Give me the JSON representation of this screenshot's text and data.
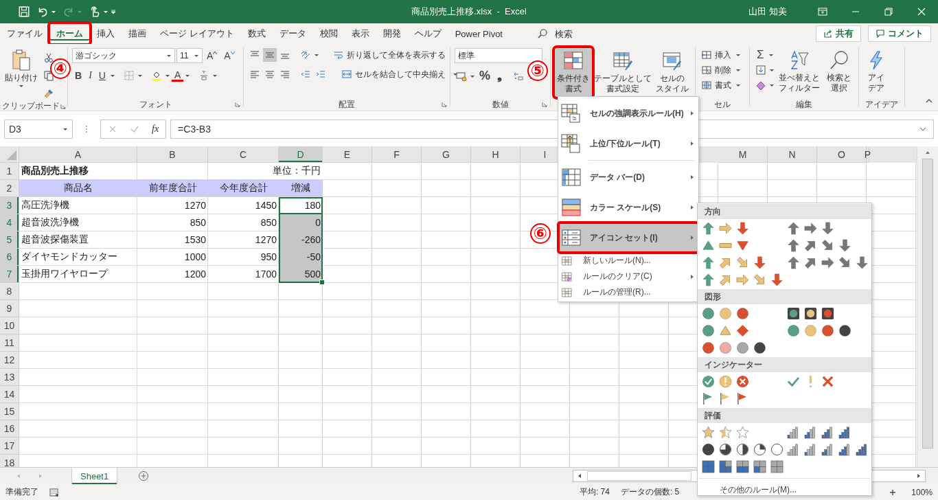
{
  "window": {
    "title": "商品別売上推移.xlsx  -  Excel",
    "user": "山田 知美"
  },
  "ribbon_tabs": [
    {
      "label": "ファイル",
      "selected": false,
      "marked": false
    },
    {
      "label": "ホーム",
      "selected": true,
      "marked": true
    },
    {
      "label": "挿入",
      "selected": false,
      "marked": false
    },
    {
      "label": "描画",
      "selected": false,
      "marked": false
    },
    {
      "label": "ページ レイアウト",
      "selected": false,
      "marked": false
    },
    {
      "label": "数式",
      "selected": false,
      "marked": false
    },
    {
      "label": "データ",
      "selected": false,
      "marked": false
    },
    {
      "label": "校閲",
      "selected": false,
      "marked": false
    },
    {
      "label": "表示",
      "selected": false,
      "marked": false
    },
    {
      "label": "開発",
      "selected": false,
      "marked": false
    },
    {
      "label": "ヘルプ",
      "selected": false,
      "marked": false
    },
    {
      "label": "Power Pivot",
      "selected": false,
      "marked": false
    }
  ],
  "search": {
    "placeholder": "検索"
  },
  "share_button": "共有",
  "comment_button": "コメント",
  "ribbon": {
    "clipboard": {
      "label": "クリップボード",
      "paste": "貼り付け"
    },
    "font": {
      "label": "フォント",
      "font_name": "游ゴシック",
      "font_size": "11",
      "grow": "A",
      "shrink": "A",
      "styles": [
        "B",
        "I",
        "U"
      ],
      "font_color": "A"
    },
    "alignment": {
      "label": "配置",
      "wrap": "折り返して全体を表示する",
      "merge": "セルを結合して中央揃え"
    },
    "number": {
      "label": "数値",
      "format": "標準",
      "percent": "%",
      "comma": "❟"
    },
    "styles": [
      {
        "lines": [
          "条件付き",
          "書式"
        ],
        "selected": true,
        "marked": true
      },
      {
        "lines": [
          "テーブルとして",
          "書式設定"
        ],
        "selected": false,
        "marked": false
      },
      {
        "lines": [
          "セルの",
          "スタイル"
        ],
        "selected": false,
        "marked": false
      }
    ],
    "cells": {
      "label": "セル",
      "buttons": [
        "挿入",
        "削除",
        "書式"
      ]
    },
    "editing": {
      "label": "編集",
      "autosum": "Σ",
      "buttons": [
        {
          "lines": [
            "並べ替えと",
            "フィルター"
          ]
        },
        {
          "lines": [
            "検索と",
            "選択"
          ]
        }
      ]
    },
    "ideas": {
      "label": "アイデア",
      "lines": [
        "アイ",
        "デア"
      ]
    }
  },
  "name_box": "D3",
  "formula": "=C3-B3",
  "function_button": "fx",
  "columns": [
    {
      "label": "A",
      "selected": false
    },
    {
      "label": "B",
      "selected": false
    },
    {
      "label": "C",
      "selected": false
    },
    {
      "label": "D",
      "selected": true
    },
    {
      "label": "E",
      "selected": false
    },
    {
      "label": "F",
      "selected": false
    },
    {
      "label": "G",
      "selected": false
    },
    {
      "label": "H",
      "selected": false
    },
    {
      "label": "I",
      "selected": false
    },
    {
      "kind": "covered"
    },
    {
      "kind": "covered"
    },
    {
      "kind": "covered"
    },
    {
      "label": "M",
      "selected": false
    },
    {
      "label": "N",
      "selected": false
    },
    {
      "label": "O",
      "selected": false
    },
    {
      "label": "P",
      "selected": false
    }
  ],
  "rows": [
    {
      "header": "1",
      "selected": false,
      "cells": [
        {
          "text": "商品別売上推移",
          "kind": "title",
          "selected": false,
          "active": false
        },
        {
          "kind": "empty"
        },
        {
          "text": "単位：千円",
          "kind": "unit",
          "selected": false,
          "active": false
        }
      ]
    },
    {
      "header": "2",
      "selected": false,
      "cells": [
        {
          "text": "商品名",
          "kind": "header",
          "selected": false,
          "active": false
        },
        {
          "text": "前年度合計",
          "kind": "header",
          "selected": false,
          "active": false
        },
        {
          "text": "今年度合計",
          "kind": "header",
          "selected": false,
          "active": false
        },
        {
          "text": "増減",
          "kind": "header",
          "selected": false,
          "active": false
        }
      ]
    },
    {
      "header": "3",
      "selected": true,
      "cells": [
        {
          "text": "高圧洗浄機",
          "kind": "label",
          "selected": false,
          "active": false
        },
        {
          "text": "1270",
          "kind": "number",
          "selected": false,
          "active": false
        },
        {
          "text": "1450",
          "kind": "number",
          "selected": false,
          "active": false
        },
        {
          "text": "180",
          "kind": "number",
          "selected": true,
          "active": true
        }
      ]
    },
    {
      "header": "4",
      "selected": true,
      "cells": [
        {
          "text": "超音波洗浄機",
          "kind": "label",
          "selected": false,
          "active": false
        },
        {
          "text": "850",
          "kind": "number",
          "selected": false,
          "active": false
        },
        {
          "text": "850",
          "kind": "number",
          "selected": false,
          "active": false
        },
        {
          "text": "0",
          "kind": "number",
          "selected": true,
          "active": false
        }
      ]
    },
    {
      "header": "5",
      "selected": true,
      "cells": [
        {
          "text": "超音波探傷装置",
          "kind": "label",
          "selected": false,
          "active": false
        },
        {
          "text": "1530",
          "kind": "number",
          "selected": false,
          "active": false
        },
        {
          "text": "1270",
          "kind": "number",
          "selected": false,
          "active": false
        },
        {
          "text": "-260",
          "kind": "number",
          "selected": true,
          "active": false
        }
      ]
    },
    {
      "header": "6",
      "selected": true,
      "cells": [
        {
          "text": "ダイヤモンドカッター",
          "kind": "label",
          "selected": false,
          "active": false
        },
        {
          "text": "1000",
          "kind": "number",
          "selected": false,
          "active": false
        },
        {
          "text": "950",
          "kind": "number",
          "selected": false,
          "active": false
        },
        {
          "text": "-50",
          "kind": "number",
          "selected": true,
          "active": false
        }
      ]
    },
    {
      "header": "7",
      "selected": true,
      "cells": [
        {
          "text": "玉掛用ワイヤロープ",
          "kind": "label",
          "selected": false,
          "active": false
        },
        {
          "text": "1200",
          "kind": "number",
          "selected": false,
          "active": false
        },
        {
          "text": "1700",
          "kind": "number",
          "selected": false,
          "active": false
        },
        {
          "text": "500",
          "kind": "number",
          "selected": true,
          "active": false
        }
      ]
    },
    {
      "header": "8",
      "selected": false
    },
    {
      "header": "9",
      "selected": false
    },
    {
      "header": "10",
      "selected": false
    },
    {
      "header": "11",
      "selected": false
    },
    {
      "header": "12",
      "selected": false
    },
    {
      "header": "13",
      "selected": false
    },
    {
      "header": "14",
      "selected": false
    },
    {
      "header": "15",
      "selected": false
    },
    {
      "header": "16",
      "selected": false
    },
    {
      "header": "17",
      "selected": false
    },
    {
      "header": "18",
      "selected": false
    }
  ],
  "conditional_format_menu": [
    {
      "label": "セルの強調表示ルール(H)",
      "kind": "highlight",
      "selected": false,
      "marked": false,
      "submenu": true
    },
    {
      "label": "上位/下位ルール(T)",
      "kind": "topbottom",
      "selected": false,
      "marked": false,
      "submenu": true
    },
    {
      "label": "データ バー(D)",
      "kind": "databar",
      "selected": false,
      "marked": false,
      "submenu": true
    },
    {
      "label": "カラー スケール(S)",
      "kind": "colorscale",
      "selected": false,
      "marked": false,
      "submenu": true
    },
    {
      "label": "アイコン セット(I)",
      "kind": "iconset",
      "selected": true,
      "marked": true,
      "submenu": true
    },
    {
      "label": "新しいルール(N)...",
      "kind": "newrule",
      "selected": false,
      "marked": false,
      "submenu": false
    },
    {
      "label": "ルールのクリア(C)",
      "kind": "clearrule",
      "selected": false,
      "marked": false,
      "submenu": true
    },
    {
      "label": "ルールの管理(R)...",
      "kind": "managerule",
      "selected": false,
      "marked": false,
      "submenu": false
    }
  ],
  "icon_set_menu": {
    "sections": [
      {
        "title": "方向",
        "kind": "direction"
      },
      {
        "title": "図形",
        "kind": "shapes"
      },
      {
        "title": "インジケーター",
        "kind": "indicators"
      },
      {
        "title": "評価",
        "kind": "ratings"
      }
    ],
    "more": "その他のルール(M)..."
  },
  "sheet_tabs": [
    {
      "label": "Sheet1",
      "selected": true
    }
  ],
  "status_bar": {
    "ready": "準備完了",
    "average": "平均: 74",
    "count": "データの個数: 5",
    "zoom": "100%"
  },
  "callouts": [
    "④",
    "⑤",
    "⑥"
  ]
}
